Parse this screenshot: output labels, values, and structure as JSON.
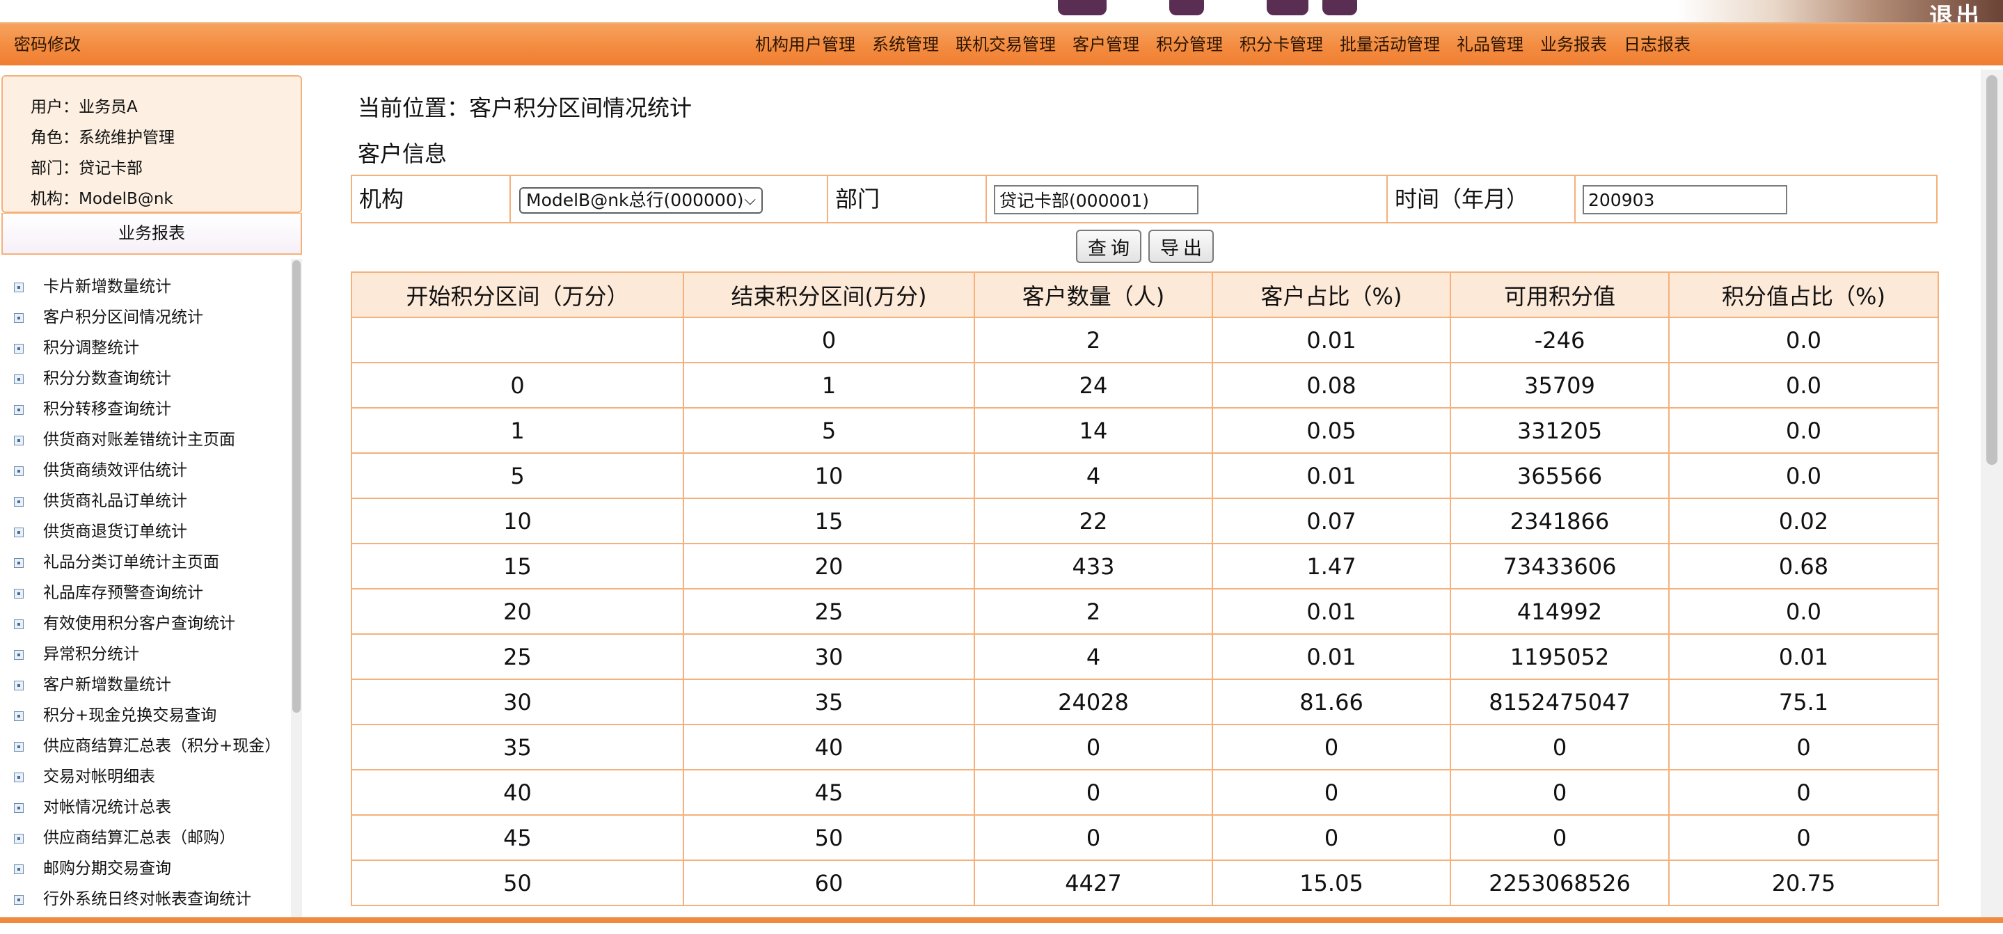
{
  "topbar": {
    "password_link": "密码修改",
    "corner_mark": "退出",
    "menu": [
      "机构用户管理",
      "系统管理",
      "联机交易管理",
      "客户管理",
      "积分管理",
      "积分卡管理",
      "批量活动管理",
      "礼品管理",
      "业务报表",
      "日志报表"
    ]
  },
  "user": {
    "name": "用户：业务员A",
    "role": "角色：系统维护管理",
    "dept": "部门：贷记卡部",
    "org": "机构：ModelB@nk"
  },
  "sidebar": {
    "title": "业务报表",
    "items": [
      "卡片新增数量统计",
      "客户积分区间情况统计",
      "积分调整统计",
      "积分分数查询统计",
      "积分转移查询统计",
      "供货商对账差错统计主页面",
      "供货商绩效评估统计",
      "供货商礼品订单统计",
      "供货商退货订单统计",
      "礼品分类订单统计主页面",
      "礼品库存预警查询统计",
      "有效使用积分客户查询统计",
      "异常积分统计",
      "客户新增数量统计",
      "积分+现金兑换交易查询",
      "供应商结算汇总表（积分+现金）",
      "交易对帐明细表",
      "对帐情况统计总表",
      "供应商结算汇总表（邮购）",
      "邮购分期交易查询",
      "行外系统日终对帐表查询统计"
    ]
  },
  "main": {
    "breadcrumb": "当前位置：客户积分区间情况统计",
    "section_title": "客户信息",
    "filters": {
      "org_label": "机构",
      "org_value": "ModelB@nk总行(000000)",
      "dept_label": "部门",
      "dept_value": "贷记卡部(000001)",
      "time_label": "时间（年月）",
      "time_value": "200903"
    },
    "buttons": {
      "query": "查询",
      "export": "导出"
    },
    "table": {
      "headers": [
        "开始积分区间（万分）",
        "结束积分区间(万分)",
        "客户数量（人)",
        "客户占比（%)",
        "可用积分值",
        "积分值占比（%)"
      ],
      "rows": [
        [
          "",
          "0",
          "2",
          "0.01",
          "-246",
          "0.0"
        ],
        [
          "0",
          "1",
          "24",
          "0.08",
          "35709",
          "0.0"
        ],
        [
          "1",
          "5",
          "14",
          "0.05",
          "331205",
          "0.0"
        ],
        [
          "5",
          "10",
          "4",
          "0.01",
          "365566",
          "0.0"
        ],
        [
          "10",
          "15",
          "22",
          "0.07",
          "2341866",
          "0.02"
        ],
        [
          "15",
          "20",
          "433",
          "1.47",
          "73433606",
          "0.68"
        ],
        [
          "20",
          "25",
          "2",
          "0.01",
          "414992",
          "0.0"
        ],
        [
          "25",
          "30",
          "4",
          "0.01",
          "1195052",
          "0.01"
        ],
        [
          "30",
          "35",
          "24028",
          "81.66",
          "8152475047",
          "75.1"
        ],
        [
          "35",
          "40",
          "0",
          "0",
          "0",
          "0"
        ],
        [
          "40",
          "45",
          "0",
          "0",
          "0",
          "0"
        ],
        [
          "45",
          "50",
          "0",
          "0",
          "0",
          "0"
        ],
        [
          "50",
          "60",
          "4427",
          "15.05",
          "2253068526",
          "20.75"
        ]
      ]
    }
  },
  "colors": {
    "nav_orange": "#f38a3e",
    "border_orange": "#f6b07a",
    "header_fill": "#fde9d8"
  }
}
